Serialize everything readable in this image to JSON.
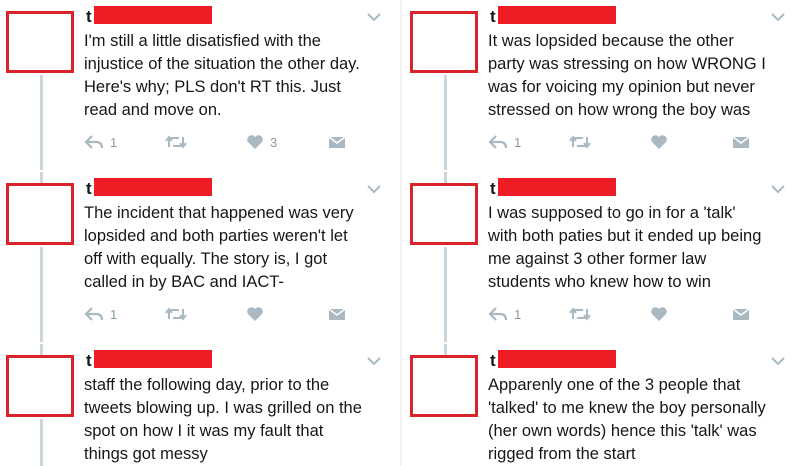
{
  "tweets": [
    {
      "handle_initial": "t",
      "text": "I'm still a little disatisfied with the\ninjustice of the situation the other day.\nHere's why; PLS don't RT this. Just\nread and move on.",
      "reply_count": "1",
      "like_count": "3"
    },
    {
      "handle_initial": "t",
      "text": "It was lopsided because the other\nparty was stressing on how WRONG I\nwas for voicing my opinion but never\nstressed on how wrong the boy was",
      "reply_count": "1",
      "like_count": ""
    },
    {
      "handle_initial": "t",
      "text": "The incident that happened was very\nlopsided and both parties weren't let\noff with equally. The story is, I got\ncalled in by BAC and IACT-",
      "reply_count": "1",
      "like_count": ""
    },
    {
      "handle_initial": "t",
      "text": "I was supposed to go in for a 'talk'\nwith both paties but it ended up being\nme against 3 other former law\nstudents who knew how to win",
      "reply_count": "1",
      "like_count": ""
    },
    {
      "handle_initial": "t",
      "text": "staff the following day, prior to the\ntweets blowing up. I was grilled on the\nspot on how I it was my fault that\nthings got messy",
      "reply_count": "",
      "like_count": ""
    },
    {
      "handle_initial": "t",
      "text": "Apparenly one of the 3 people that\n'talked' to me knew the boy personally\n(her own words) hence this 'talk' was\nrigged from the start",
      "reply_count": "",
      "like_count": ""
    }
  ],
  "icons": {
    "reply": "reply-icon",
    "retweet": "retweet-icon",
    "like": "heart-icon",
    "message": "direct-message-icon",
    "menu": "chevron-down-icon"
  },
  "colors": {
    "redaction": "#ee1c24",
    "avatar_border": "#d9232a",
    "icon_gray": "#aab8c2",
    "thread_line": "#ccd6dd"
  }
}
